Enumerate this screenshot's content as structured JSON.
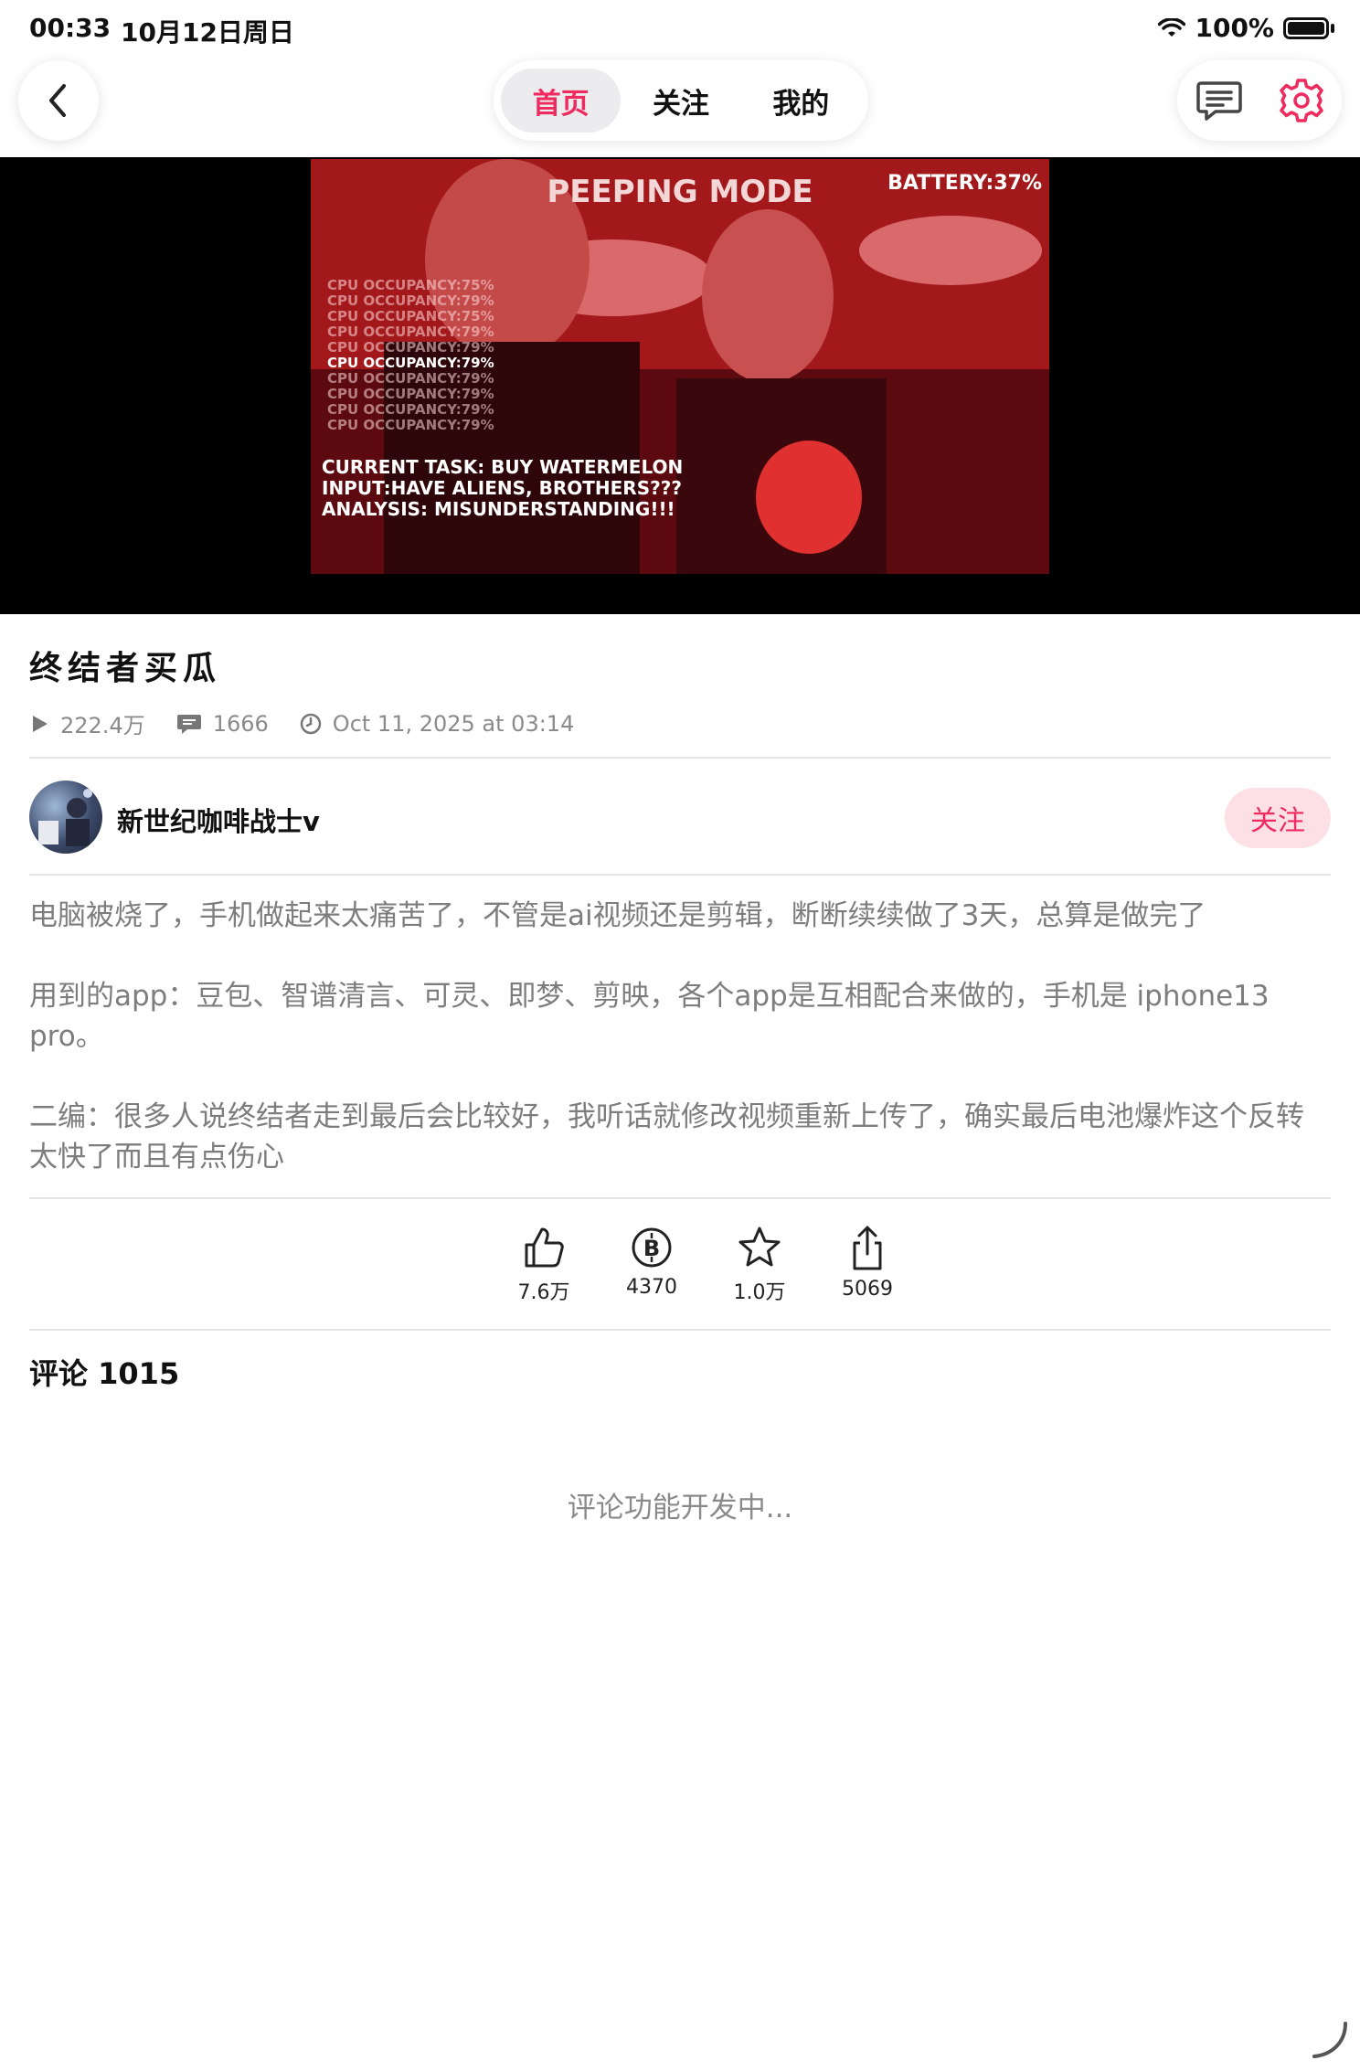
{
  "status_bar": {
    "time": "00:33",
    "date": "10月12日周日",
    "battery_percent": "100%"
  },
  "nav": {
    "tabs": [
      {
        "label": "首页",
        "active": true
      },
      {
        "label": "关注",
        "active": false
      },
      {
        "label": "我的",
        "active": false
      }
    ],
    "back_icon": "chevron-left-icon",
    "message_icon": "message-icon",
    "settings_icon": "gear-icon"
  },
  "video": {
    "overlay_title": "PEEPING MODE",
    "overlay_battery": "BATTERY:37%",
    "cpu_lines": [
      "CPU OCCUPANCY:75%",
      "CPU OCCUPANCY:79%",
      "CPU OCCUPANCY:75%",
      "CPU OCCUPANCY:79%",
      "CPU OCCUPANCY:79%",
      "CPU OCCUPANCY:79%",
      "CPU OCCUPANCY:79%",
      "CPU OCCUPANCY:79%",
      "CPU OCCUPANCY:79%",
      "CPU OCCUPANCY:79%"
    ],
    "task_lines": [
      "CURRENT TASK: BUY WATERMELON",
      "INPUT:HAVE ALIENS, BROTHERS???",
      "ANALYSIS: MISUNDERSTANDING!!!"
    ]
  },
  "post": {
    "title": "终结者买瓜",
    "views": "222.4万",
    "comments_count": "1666",
    "date": "Oct 11, 2025 at 03:14"
  },
  "author": {
    "name": "新世纪咖啡战士v",
    "follow_label": "关注"
  },
  "description": {
    "p1": "电脑被烧了，手机做起来太痛苦了，不管是ai视频还是剪辑，断断续续做了3天，总算是做完了",
    "p2": "用到的app：豆包、智谱清言、可灵、即梦、剪映，各个app是互相配合来做的，手机是 iphone13 pro。",
    "p3": "二编：很多人说终结者走到最后会比较好，我听话就修改视频重新上传了，确实最后电池爆炸这个反转太快了而且有点伤心"
  },
  "actions": {
    "like": "7.6万",
    "coin": "4370",
    "favorite": "1.0万",
    "share": "5069"
  },
  "comments": {
    "header": "评论 1015",
    "empty_text": "评论功能开发中..."
  },
  "colors": {
    "accent": "#ee2a5e",
    "follow_bg": "#fde0e6",
    "secondary_text": "#8a8a8a"
  }
}
